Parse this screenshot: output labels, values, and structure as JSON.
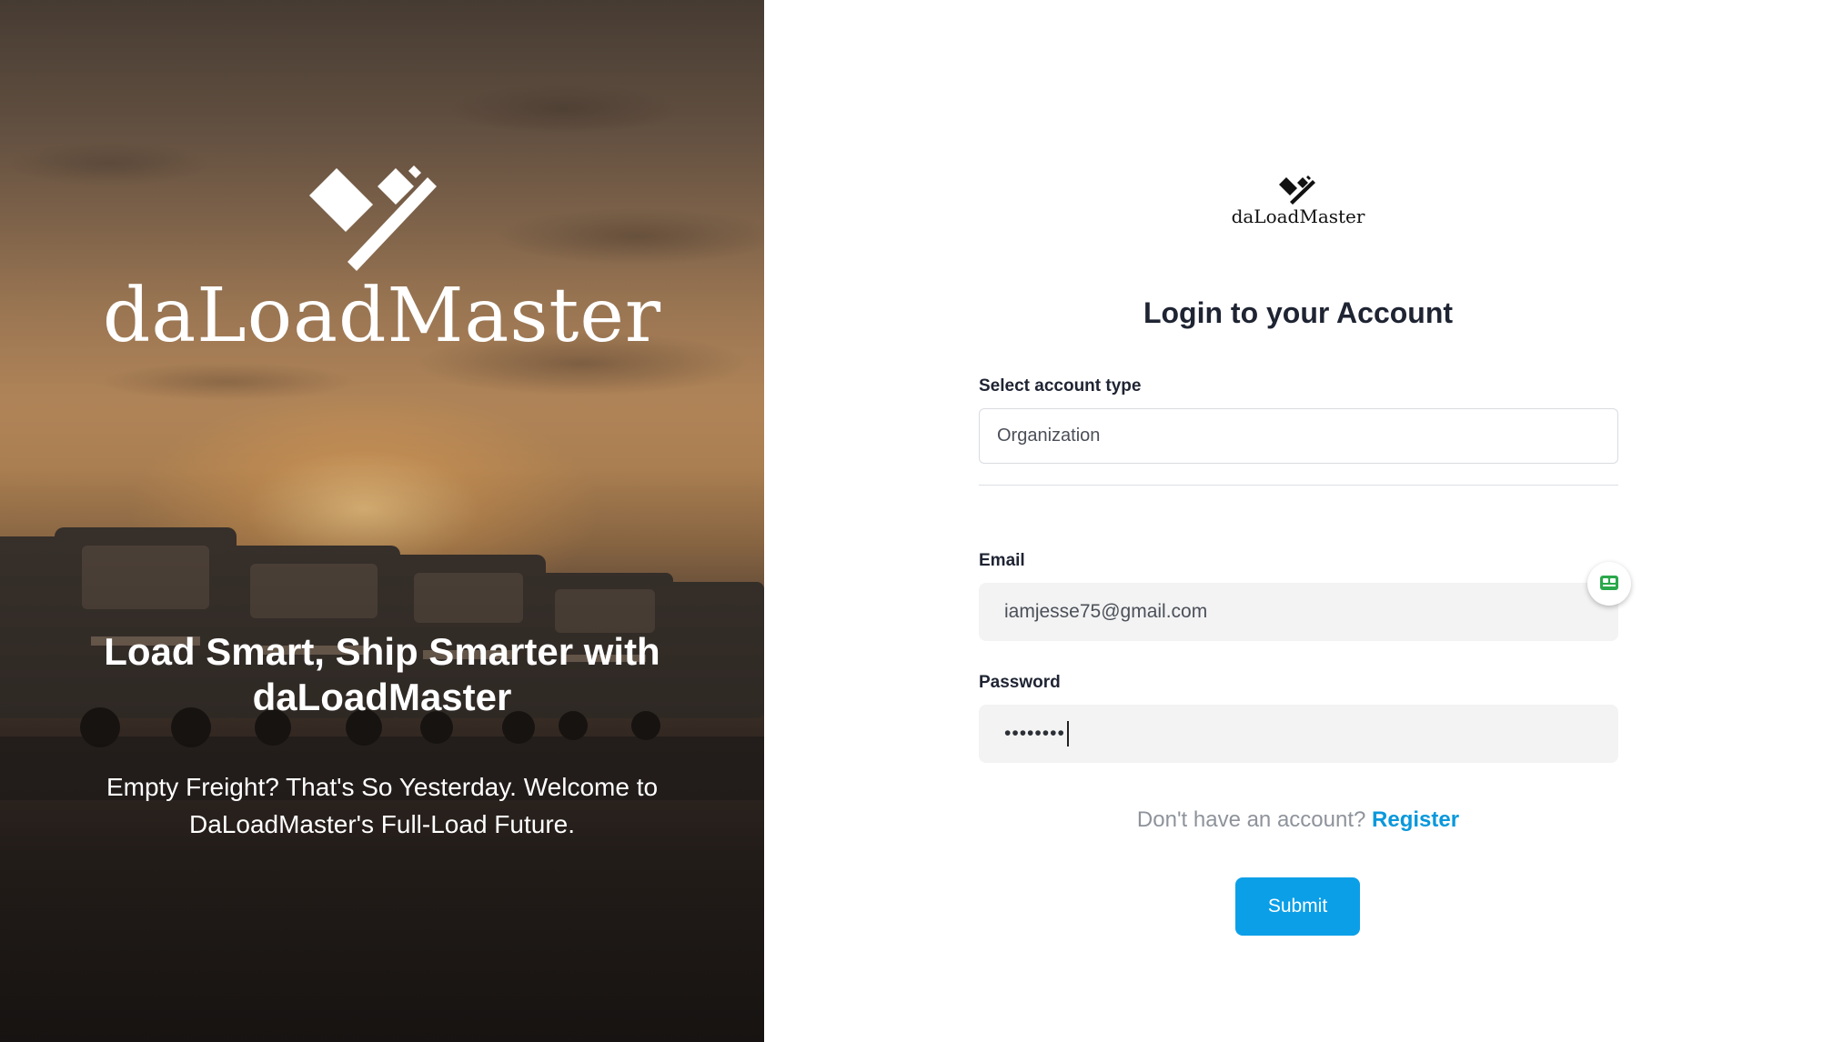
{
  "hero": {
    "brand": "daLoadMaster",
    "headline": "Load Smart, Ship Smarter with daLoadMaster",
    "subtext": "Empty Freight? That's So Yesterday. Welcome to DaLoadMaster's Full-Load Future."
  },
  "login": {
    "brand": "daLoadMaster",
    "title": "Login to your Account",
    "account_type": {
      "label": "Select account type",
      "selected": "Organization"
    },
    "email": {
      "label": "Email",
      "value": "iamjesse75@gmail.com"
    },
    "password": {
      "label": "Password",
      "masked_value": "••••••••"
    },
    "register_prompt": "Don't have an account?",
    "register_link": "Register",
    "submit_label": "Submit"
  },
  "colors": {
    "accent": "#0b9fe8",
    "link": "#0a98dc",
    "heading": "#1f2433",
    "extension_badge": "#2aa84a"
  },
  "icons": {
    "brand_logo": "diamond-check-logo",
    "extension": "password-manager-icon"
  }
}
